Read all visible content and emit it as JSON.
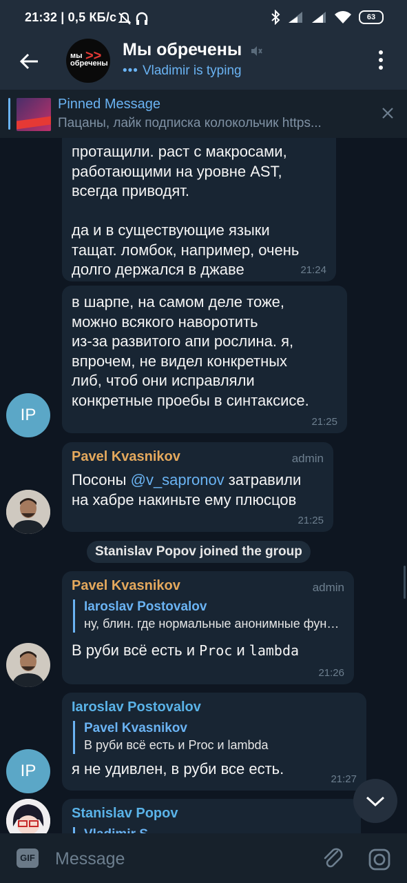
{
  "status_bar": {
    "time_speed": "21:32 | 0,5 КБ/с",
    "battery": "63"
  },
  "header": {
    "title": "Мы обречены",
    "typing": "Vladimir is typing",
    "typing_dots": "•••",
    "avatar_text_1": "мы обречены",
    "avatar_text_2": ">>"
  },
  "pinned": {
    "title": "Pinned Message",
    "text": "Пацаны, лайк подписка колокольчик https..."
  },
  "messages": {
    "m1": {
      "text": "протащили. раст с макросами,\nработающими на уровне AST,\nвсегда приводят.\n\nда и в существующие языки\nтащат. ломбок, например, очень\nдолго держался в джаве",
      "time": "21:24"
    },
    "m2": {
      "text": "в шарпе, на самом деле тоже,\nможно всякого наворотить\nиз-за развитого апи рослина. я,\nвпрочем, не видел конкретных\nлиб, чтоб они исправляли\nконкретные проебы в синтаксисе.",
      "time": "21:25",
      "avatar": "IP"
    },
    "m3": {
      "sender": "Pavel Kvasnikov",
      "badge": "admin",
      "text_1": "Посоны ",
      "mention": "@v_sapronov",
      "text_2": " затравили\nна хабре накиньте ему плюсцов",
      "time": "21:25"
    },
    "service": "Stanislav Popov joined the group",
    "m4": {
      "sender": "Pavel Kvasnikov",
      "badge": "admin",
      "quote_name": "Iaroslav Postovalov",
      "quote_text": "ну, блин. где нормальные анонимные функции",
      "text_1": "В руби всё есть и ",
      "code_1": "Proc",
      "text_2": " и ",
      "code_2": "lambda",
      "time": "21:26"
    },
    "m5": {
      "sender": "Iaroslav Postovalov",
      "quote_name": "Pavel Kvasnikov",
      "quote_text": "В руби всё есть и Proc и lambda",
      "text": "я не удивлен, в руби все есть.",
      "time": "21:27",
      "avatar": "IP"
    },
    "m6": {
      "sender": "Stanislav Popov",
      "quote_name": "Vladimir S..."
    }
  },
  "input": {
    "gif_label": "GIF",
    "placeholder": "Message"
  },
  "colors": {
    "background": "#0e1621",
    "header": "#212d3b",
    "bubble": "#182533",
    "accent": "#6ab3f3",
    "admin_name": "#e5a95d"
  }
}
